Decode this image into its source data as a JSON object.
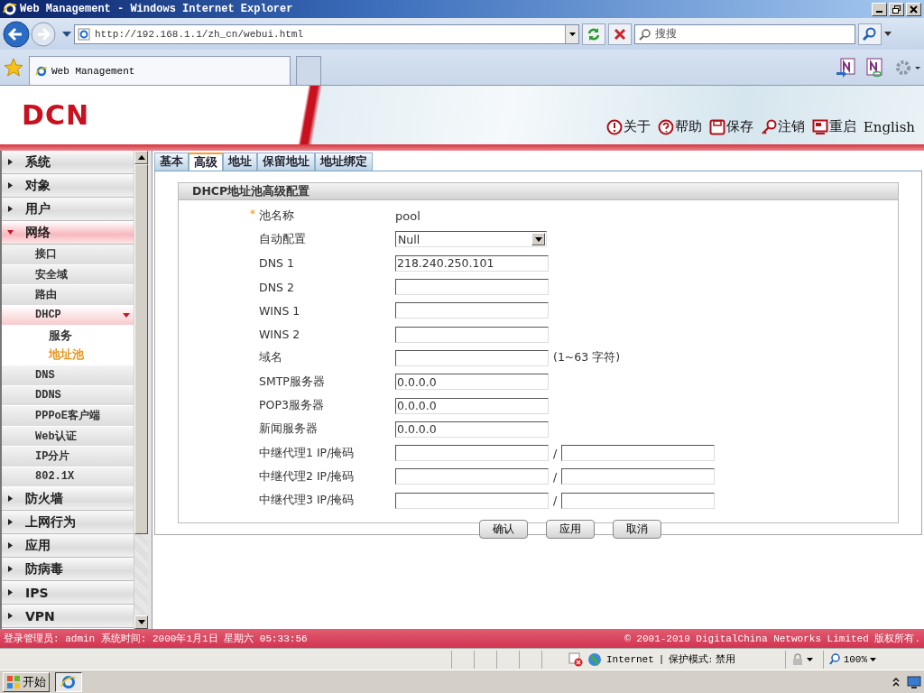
{
  "window": {
    "title": "Web Management - Windows Internet Explorer"
  },
  "address_bar": {
    "url": "http://192.168.1.1/zh_cn/webui.html"
  },
  "search": {
    "placeholder": "搜搜"
  },
  "browser_tabs": [
    {
      "label": "Web Management",
      "selected": true
    }
  ],
  "banner": {
    "logo": "DCN",
    "links": [
      {
        "label": "关于",
        "kind": "about"
      },
      {
        "label": "帮助",
        "kind": "help"
      },
      {
        "label": "保存",
        "kind": "save"
      },
      {
        "label": "注销",
        "kind": "logout"
      },
      {
        "label": "重启",
        "kind": "restart"
      },
      {
        "label": "English",
        "kind": "language"
      }
    ]
  },
  "sidebar": {
    "items": [
      {
        "label": "系统",
        "expanded": false,
        "selected": false
      },
      {
        "label": "对象",
        "expanded": false,
        "selected": false
      },
      {
        "label": "用户",
        "expanded": false,
        "selected": false
      },
      {
        "label": "网络",
        "expanded": true,
        "selected": true,
        "children": [
          {
            "label": "接口",
            "selected": false
          },
          {
            "label": "安全域",
            "selected": false
          },
          {
            "label": "路由",
            "selected": false
          },
          {
            "label": "DHCP",
            "selected": true,
            "expanded": true,
            "children": [
              {
                "label": "服务",
                "selected": false
              },
              {
                "label": "地址池",
                "selected": true
              }
            ]
          },
          {
            "label": "DNS",
            "selected": false
          },
          {
            "label": "DDNS",
            "selected": false
          },
          {
            "label": "PPPoE客户端",
            "selected": false
          },
          {
            "label": "Web认证",
            "selected": false
          },
          {
            "label": "IP分片",
            "selected": false
          },
          {
            "label": "802.1X",
            "selected": false
          }
        ]
      },
      {
        "label": "防火墙",
        "expanded": false,
        "selected": false
      },
      {
        "label": "上网行为",
        "expanded": false,
        "selected": false
      },
      {
        "label": "应用",
        "expanded": false,
        "selected": false
      },
      {
        "label": "防病毒",
        "expanded": false,
        "selected": false
      },
      {
        "label": "IPS",
        "expanded": false,
        "selected": false
      },
      {
        "label": "VPN",
        "expanded": false,
        "selected": false
      }
    ]
  },
  "tabs": [
    {
      "label": "基本",
      "selected": false
    },
    {
      "label": "高级",
      "selected": true
    },
    {
      "label": "地址",
      "selected": false
    },
    {
      "label": "保留地址",
      "selected": false
    },
    {
      "label": "地址绑定",
      "selected": false
    }
  ],
  "panel": {
    "title": "DHCP地址池高级配置",
    "required_mark": "*",
    "rows": [
      {
        "kind": "text",
        "label": "池名称",
        "required": true,
        "value": "pool"
      },
      {
        "kind": "select",
        "label": "自动配置",
        "required": false,
        "value": "Null"
      },
      {
        "kind": "input",
        "label": "DNS 1",
        "required": false,
        "value": "218.240.250.101"
      },
      {
        "kind": "input",
        "label": "DNS 2",
        "required": false
      },
      {
        "kind": "input",
        "label": "WINS 1",
        "required": false
      },
      {
        "kind": "input",
        "label": "WINS 2",
        "required": false
      },
      {
        "kind": "input",
        "label": "域名",
        "required": false,
        "hint": "(1~63 字符)"
      },
      {
        "kind": "input",
        "label": "SMTP服务器",
        "required": false,
        "value": "0.0.0.0"
      },
      {
        "kind": "input",
        "label": "POP3服务器",
        "required": false,
        "value": "0.0.0.0"
      },
      {
        "kind": "input",
        "label": "新闻服务器",
        "required": false,
        "value": "0.0.0.0"
      },
      {
        "kind": "pair",
        "label": "中继代理1 IP/掩码",
        "required": false,
        "separator": "/"
      },
      {
        "kind": "pair",
        "label": "中继代理2 IP/掩码",
        "required": false,
        "separator": "/"
      },
      {
        "kind": "pair",
        "label": "中继代理3 IP/掩码",
        "required": false,
        "separator": "/"
      }
    ],
    "buttons": [
      "确认",
      "应用",
      "取消"
    ]
  },
  "footer": {
    "login": "登录管理员: admin 系统时间: 2000年1月1日 星期六 05:33:56",
    "copyright": "© 2001-2010 DigitalChina Networks Limited 版权所有."
  },
  "status_bar": {
    "zone": "Internet",
    "separator": "|",
    "protected_mode": "保护模式: 禁用",
    "zoom": "100%"
  },
  "taskbar": {
    "start": "开始"
  }
}
